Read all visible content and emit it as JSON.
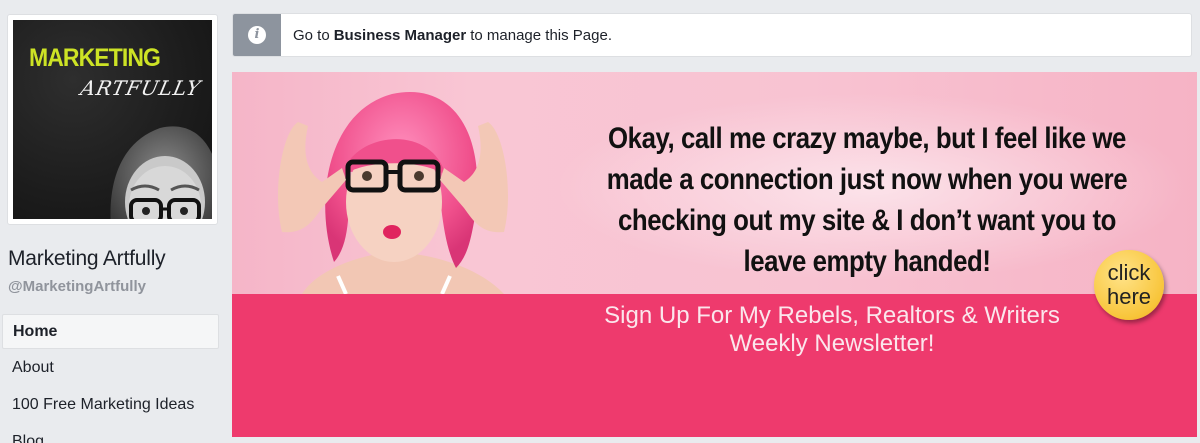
{
  "page": {
    "profile_logo": {
      "line1": "MARKETING",
      "line2": "ARTFULLY"
    },
    "name": "Marketing Artfully",
    "handle": "@MarketingArtfully"
  },
  "nav": {
    "items": [
      {
        "label": "Home",
        "active": true
      },
      {
        "label": "About"
      },
      {
        "label": "100 Free Marketing Ideas"
      },
      {
        "label": "Blog"
      }
    ]
  },
  "notice": {
    "icon": "info-icon",
    "prefix": "Go to",
    "bold": "Business Manager",
    "suffix": "to manage this Page."
  },
  "cover": {
    "headline": "Okay, call me crazy maybe, but I feel like we made a connection just now when you were checking out my site & I don’t want you to leave empty handed!",
    "signup_line1": "Sign Up For My Rebels, Realtors & Writers",
    "signup_line2": "Weekly Newsletter!",
    "cta_line1": "click",
    "cta_line2": "here"
  },
  "colors": {
    "background": "#e9ebee",
    "cover_pink_light": "#f8c3d2",
    "cover_pink_dark": "#ee3a6d",
    "logo_accent": "#cde325",
    "cta_yellow": "#f8c53a",
    "notice_icon_bg": "#8d949e"
  }
}
